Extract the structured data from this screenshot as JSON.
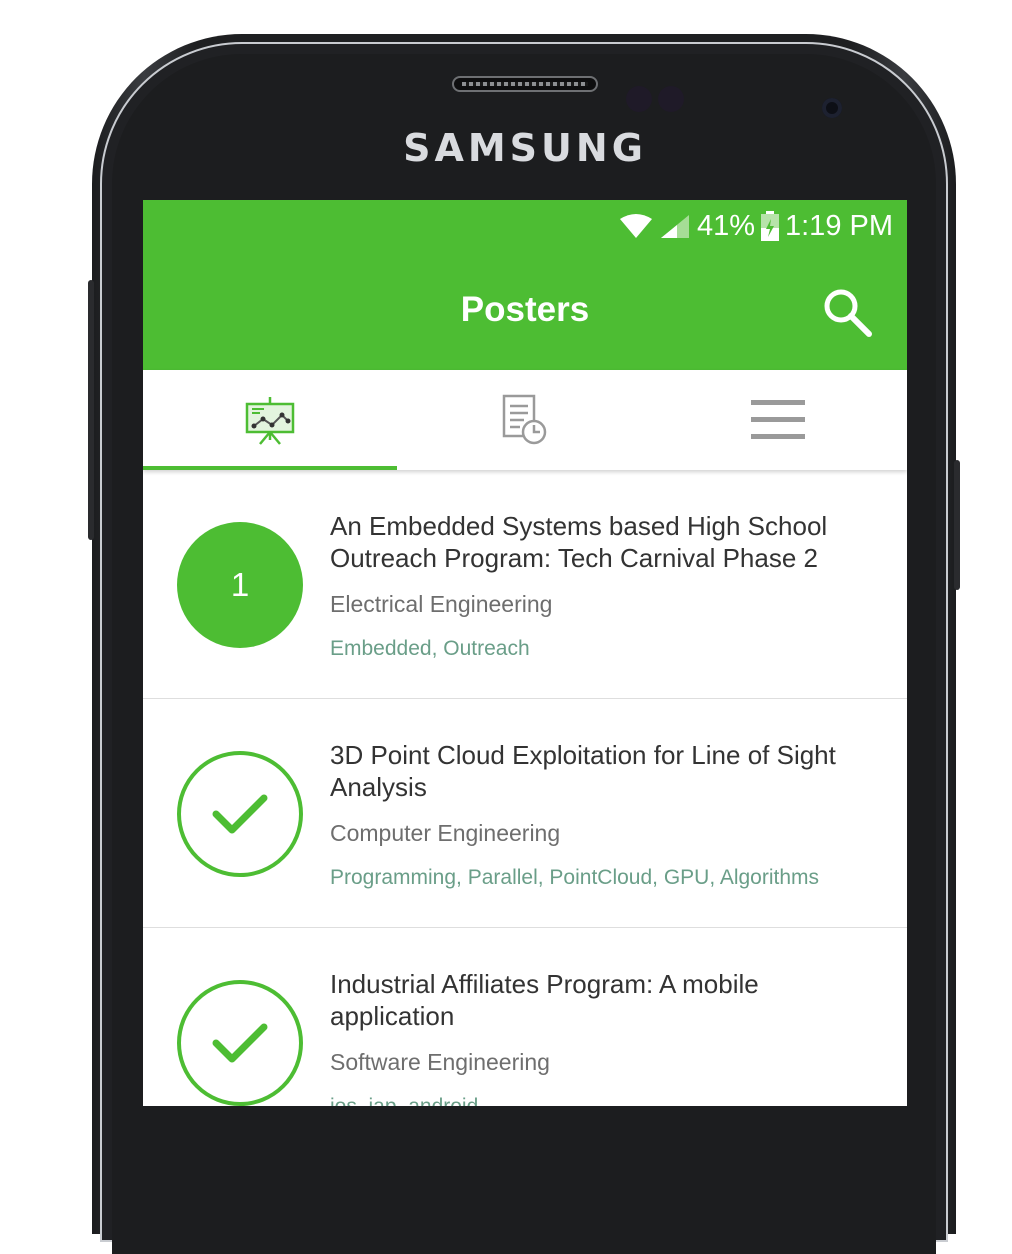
{
  "device": {
    "brand": "SAMSUNG"
  },
  "status_bar": {
    "battery": "41%",
    "time": "1:19 PM"
  },
  "app_bar": {
    "title": "Posters"
  },
  "tabs": [
    {
      "icon": "presentation-board-icon",
      "active": true
    },
    {
      "icon": "document-clock-icon",
      "active": false
    },
    {
      "icon": "hamburger-menu-icon",
      "active": false
    }
  ],
  "posters": [
    {
      "badge": "1",
      "title": "An Embedded Systems based High School Outreach Program: Tech Carnival Phase 2",
      "department": "Electrical Engineering",
      "tags": "Embedded, Outreach"
    },
    {
      "badge": "check",
      "title": "3D Point Cloud Exploitation for Line of Sight Analysis",
      "department": "Computer Engineering",
      "tags": "Programming, Parallel, PointCloud, GPU, Algorithms"
    },
    {
      "badge": "check",
      "title": "Industrial Affiliates Program: A mobile application",
      "department": "Software Engineering",
      "tags": "ios, iap, android"
    }
  ],
  "colors": {
    "primary": "#4dbd33",
    "tag_text": "#6a9e88",
    "title_text": "#333333"
  }
}
